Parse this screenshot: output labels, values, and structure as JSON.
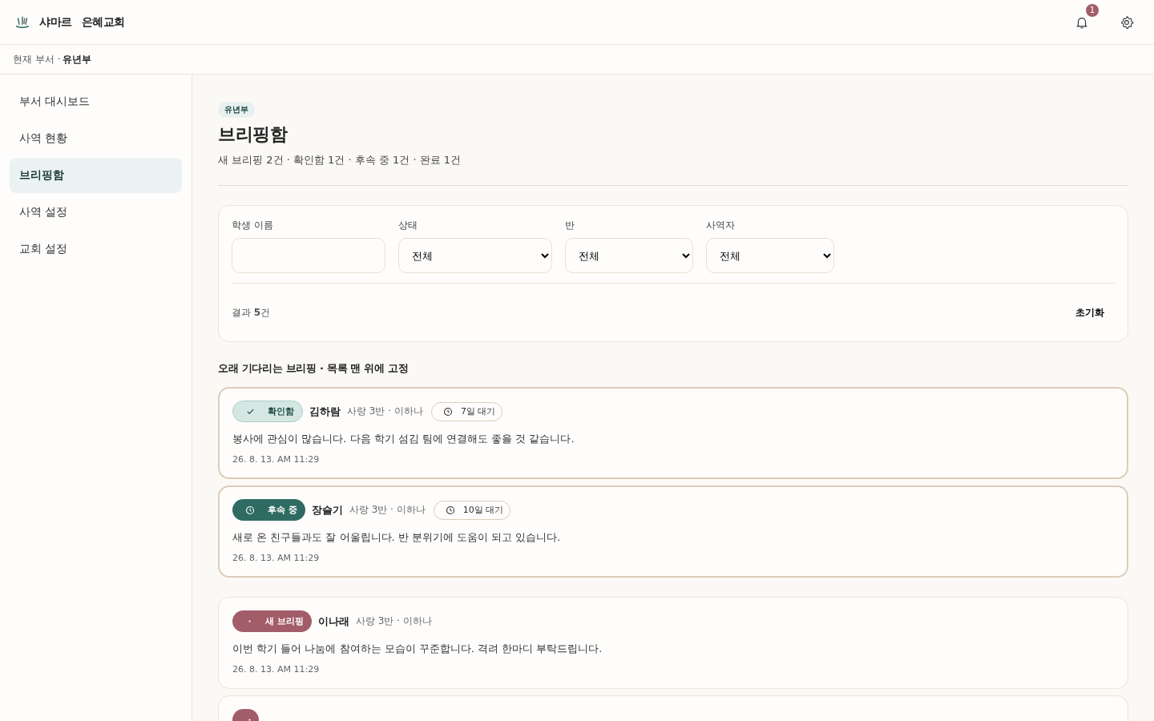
{
  "header": {
    "brand": "샤마르",
    "church": "은혜교회",
    "notifications": "1"
  },
  "breadcrumb": {
    "label": "현재 부서 · ",
    "department": "유년부"
  },
  "sidebar": {
    "items": [
      {
        "label": "부서 대시보드",
        "selected": false
      },
      {
        "label": "사역 현황",
        "selected": false
      },
      {
        "label": "브리핑함",
        "selected": true
      },
      {
        "label": "사역 설정",
        "selected": false
      },
      {
        "label": "교회 설정",
        "selected": false
      }
    ]
  },
  "page": {
    "tag": "유년부",
    "title": "브리핑함",
    "summary": "새 브리핑 2건 · 확인함 1건 · 후속 중 1건 · 완료 1건"
  },
  "filters": {
    "fields": [
      {
        "label": "학생 이름",
        "kind": "text"
      },
      {
        "label": "상태",
        "kind": "select",
        "value": "전체"
      },
      {
        "label": "반",
        "kind": "select",
        "value": "전체"
      },
      {
        "label": "사역자",
        "kind": "select",
        "value": "전체"
      }
    ],
    "result": "결과 **5**건",
    "reset": "초기화"
  },
  "pinned_heading": "오래 기다리는 브리핑 · 목록 맨 위에 고정",
  "pinned": [
    {
      "status": "확인함",
      "kind": "confirmed",
      "name": "김하람",
      "meta": "사랑 3반 · 이하나",
      "wait": "7일 대기",
      "body": "봉사에 관심이 많습니다. 다음 학기 섬김 팀에 연결해도 좋을 것 같습니다.",
      "date": "26. 8. 13. AM 11:29"
    },
    {
      "status": "후속 중",
      "kind": "followup",
      "name": "장슬기",
      "meta": "사랑 3반 · 이하나",
      "wait": "10일 대기",
      "body": "새로 온 친구들과도 잘 어울립니다. 반 분위기에 도움이 되고 있습니다.",
      "date": "26. 8. 13. AM 11:29"
    }
  ],
  "briefings": [
    {
      "status": "새 브리핑",
      "kind": "new",
      "name": "이나래",
      "meta": "사랑 3반 · 이하나",
      "body": "이번 학기 들어 나눔에 참여하는 모습이 꾸준합니다. 격려 한마디 부탁드립니다.",
      "date": "26. 8. 13. AM 11:29"
    },
    {
      "kind": "new"
    }
  ]
}
